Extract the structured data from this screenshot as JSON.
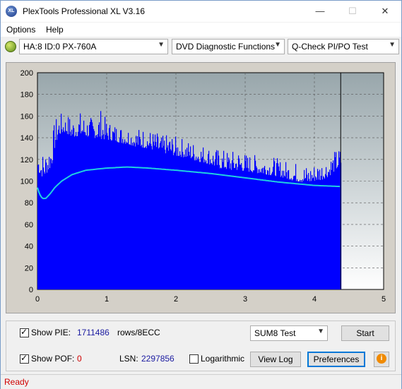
{
  "window": {
    "title": "PlexTools Professional XL V3.16",
    "icon_text": "XL"
  },
  "title_buttons": {
    "minimize": "—",
    "maximize": "☐",
    "close": "✕"
  },
  "menu": {
    "options": "Options",
    "help": "Help"
  },
  "toolbar": {
    "drive": "HA:8 ID:0  PX-760A",
    "function": "DVD Diagnostic Functions",
    "test": "Q-Check PI/PO Test"
  },
  "chart_data": {
    "type": "bar",
    "title": "",
    "xlabel": "",
    "ylabel": "",
    "xlim": [
      0,
      5
    ],
    "ylim": [
      0,
      200
    ],
    "x_ticks": [
      "0",
      "1",
      "2",
      "3",
      "4",
      "5"
    ],
    "y_ticks": [
      "0",
      "20",
      "40",
      "60",
      "80",
      "100",
      "120",
      "140",
      "160",
      "180",
      "200"
    ],
    "grid": true,
    "data_end_x": 4.38,
    "colors": {
      "bars": "#0000ff",
      "line": "#20d0e0",
      "background_top": "#9aaab0",
      "background_bottom": "#ffffff"
    },
    "series": [
      {
        "name": "PIE",
        "type": "bar",
        "x": [
          0.0,
          0.05,
          0.1,
          0.15,
          0.2,
          0.25,
          0.3,
          0.35,
          0.4,
          0.45,
          0.5,
          0.6,
          0.7,
          0.8,
          0.9,
          1.0,
          1.1,
          1.2,
          1.3,
          1.4,
          1.5,
          1.6,
          1.7,
          1.8,
          1.9,
          2.0,
          2.1,
          2.2,
          2.3,
          2.4,
          2.5,
          2.6,
          2.7,
          2.8,
          2.9,
          3.0,
          3.1,
          3.2,
          3.3,
          3.4,
          3.5,
          3.6,
          3.7,
          3.8,
          3.9,
          4.0,
          4.1,
          4.2,
          4.3,
          4.38
        ],
        "values": [
          118,
          112,
          113,
          117,
          122,
          140,
          150,
          152,
          153,
          150,
          148,
          150,
          149,
          148,
          147,
          146,
          145,
          143,
          142,
          140,
          139,
          138,
          136,
          134,
          133,
          131,
          130,
          129,
          126,
          125,
          123,
          120,
          119,
          118,
          118,
          117,
          116,
          115,
          114,
          113,
          112,
          110,
          108,
          107,
          106,
          108,
          109,
          112,
          118,
          122
        ],
        "peaks": [
          128,
          126,
          125,
          133,
          140,
          156,
          160,
          161,
          158,
          160,
          157,
          163,
          158,
          157,
          166,
          154,
          152,
          150,
          149,
          147,
          148,
          146,
          144,
          140,
          142,
          139,
          138,
          135,
          134,
          132,
          130,
          128,
          127,
          126,
          128,
          124,
          123,
          122,
          122,
          121,
          118,
          117,
          116,
          115,
          113,
          115,
          118,
          121,
          127,
          130
        ]
      },
      {
        "name": "SUM8",
        "type": "line",
        "x": [
          0.0,
          0.03,
          0.07,
          0.12,
          0.18,
          0.25,
          0.35,
          0.5,
          0.7,
          1.0,
          1.3,
          1.6,
          2.0,
          2.5,
          3.0,
          3.5,
          4.0,
          4.38
        ],
        "values": [
          94,
          88,
          84,
          84,
          88,
          94,
          100,
          106,
          110,
          112,
          113,
          112,
          110,
          107,
          103,
          99,
          96,
          95
        ]
      }
    ]
  },
  "controls": {
    "show_pie_label": "Show PIE:",
    "pie_value": "1711486",
    "pie_unit": "rows/8ECC",
    "test_mode": "SUM8 Test",
    "start": "Start",
    "show_pof_label": "Show POF:",
    "pof_value": "0",
    "lsn_label": "LSN:",
    "lsn_value": "2297856",
    "logarithmic": "Logarithmic",
    "view_log": "View Log",
    "preferences": "Preferences",
    "info": "i"
  },
  "status": {
    "text": "Ready"
  }
}
